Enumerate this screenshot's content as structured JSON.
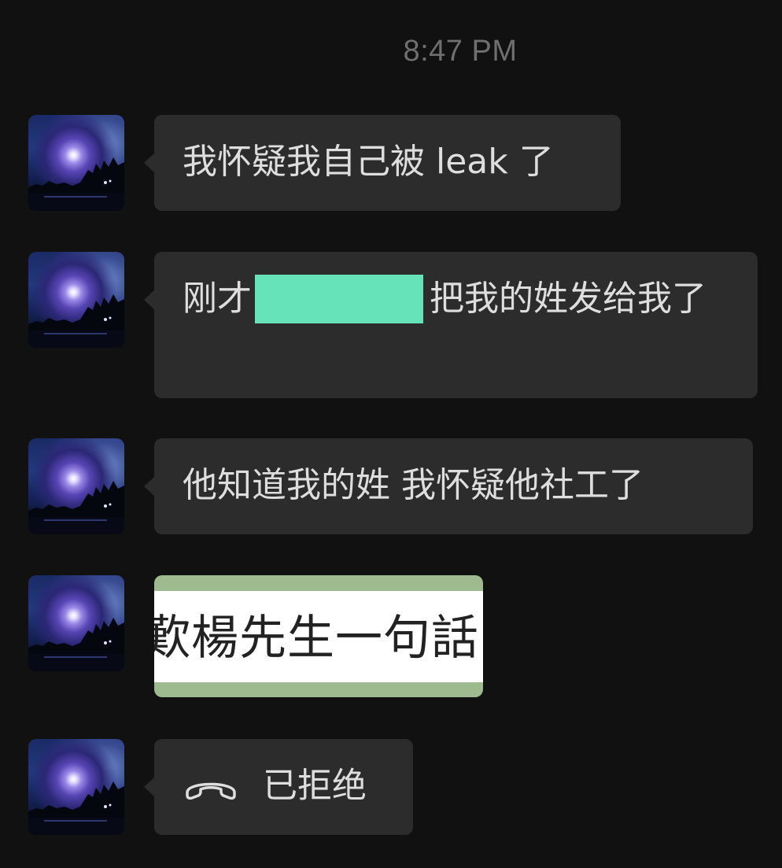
{
  "chat": {
    "timestamp": "8:47 PM",
    "messages": [
      {
        "type": "text",
        "text": "我怀疑我自己被 leak 了"
      },
      {
        "type": "text_redacted",
        "before": "刚才",
        "after": "把我的姓发给我了"
      },
      {
        "type": "text",
        "text": "他知道我的姓 我怀疑他社工了"
      },
      {
        "type": "image",
        "image_text": "歎楊先生一句話"
      },
      {
        "type": "call",
        "icon": "phone-declined-icon",
        "text": "已拒绝"
      }
    ]
  },
  "colors": {
    "background": "#111111",
    "bubble": "#2c2c2c",
    "text": "#dedede",
    "timestamp": "#6f6f6f",
    "redaction": "#66e3b9"
  }
}
